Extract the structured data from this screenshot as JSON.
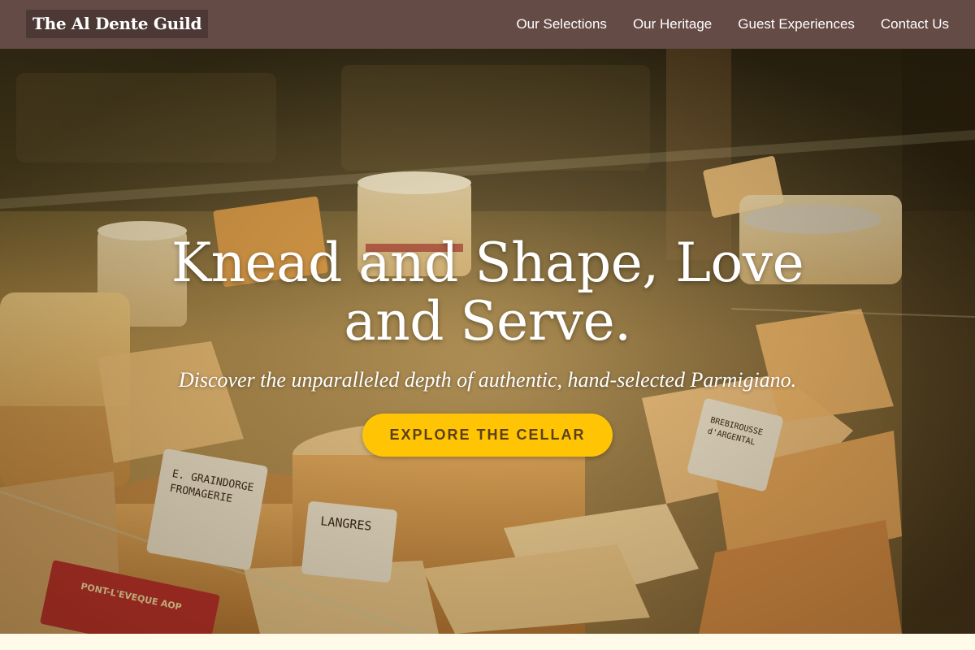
{
  "brand": {
    "name": "The Al Dente Guild"
  },
  "nav": {
    "items": [
      {
        "label": "Our Selections"
      },
      {
        "label": "Our Heritage"
      },
      {
        "label": "Guest Experiences"
      },
      {
        "label": "Contact Us"
      }
    ]
  },
  "hero": {
    "title": "Knead and Shape, Love and Serve.",
    "subtitle": "Discover the unparalleled depth of authentic, hand-selected Parmigiano.",
    "cta_label": "EXPLORE THE CELLAR",
    "background_image": "cheese-display-case-photo",
    "label_cards": [
      {
        "text": "E. GRAINDORGE FROMAGERIE"
      },
      {
        "text": "LANGRES"
      },
      {
        "text": "BREBIROUSSE d'ARGENTAL"
      },
      {
        "text": "PONT-L'EVEQUE AOP"
      }
    ]
  },
  "colors": {
    "header_bg": "#654b45",
    "logo_bg": "#4c3834",
    "cta_bg": "#ffc505",
    "cta_text": "#5b3f17",
    "page_bg": "#fffbe8"
  }
}
